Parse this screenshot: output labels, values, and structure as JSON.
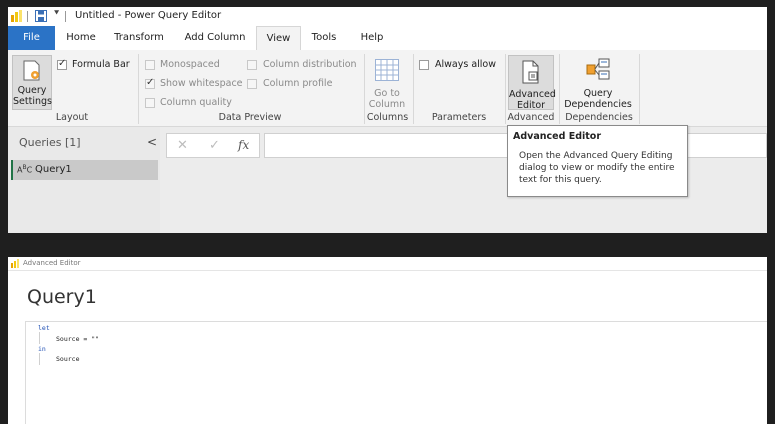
{
  "title_bar": {
    "title": "Untitled - Power Query Editor"
  },
  "menu": {
    "tabs": [
      "File",
      "Home",
      "Transform",
      "Add Column",
      "View",
      "Tools",
      "Help"
    ],
    "active": "View"
  },
  "ribbon": {
    "layout": {
      "query_settings": "Query Settings",
      "formula_bar": "Formula Bar",
      "formula_bar_checked": true,
      "group": "Layout"
    },
    "data_preview": {
      "monospaced": "Monospaced",
      "show_whitespace": "Show whitespace",
      "column_quality": "Column quality",
      "column_distribution": "Column distribution",
      "column_profile": "Column profile",
      "group": "Data Preview"
    },
    "columns": {
      "go_to_column": "Go to Column",
      "group": "Columns"
    },
    "parameters": {
      "always_allow": "Always allow",
      "group": "Parameters"
    },
    "advanced": {
      "advanced_editor": "Advanced Editor",
      "group": "Advanced"
    },
    "dependencies": {
      "query_dependencies": "Query Dependencies",
      "group": "Dependencies"
    }
  },
  "queries_pane": {
    "header": "Queries [1]",
    "collapse": "<",
    "items": [
      {
        "type_icon": "ABC",
        "name": "Query1"
      }
    ]
  },
  "formula_bar": {
    "cancel": "✕",
    "commit": "✓",
    "fx": "fx",
    "value": ""
  },
  "tooltip": {
    "title": "Advanced Editor",
    "lines": [
      "Open the Advanced Query Editing",
      "dialog to view or modify the entire",
      "text for this query."
    ]
  },
  "advanced_editor": {
    "window_title": "Advanced Editor",
    "query_name": "Query1",
    "code": {
      "line1": "let",
      "line2": "Source = \"\"",
      "line3": "in",
      "line4": "Source"
    }
  },
  "colors": {
    "accent": "#2b73c6",
    "app_icon": "#f2c811"
  }
}
